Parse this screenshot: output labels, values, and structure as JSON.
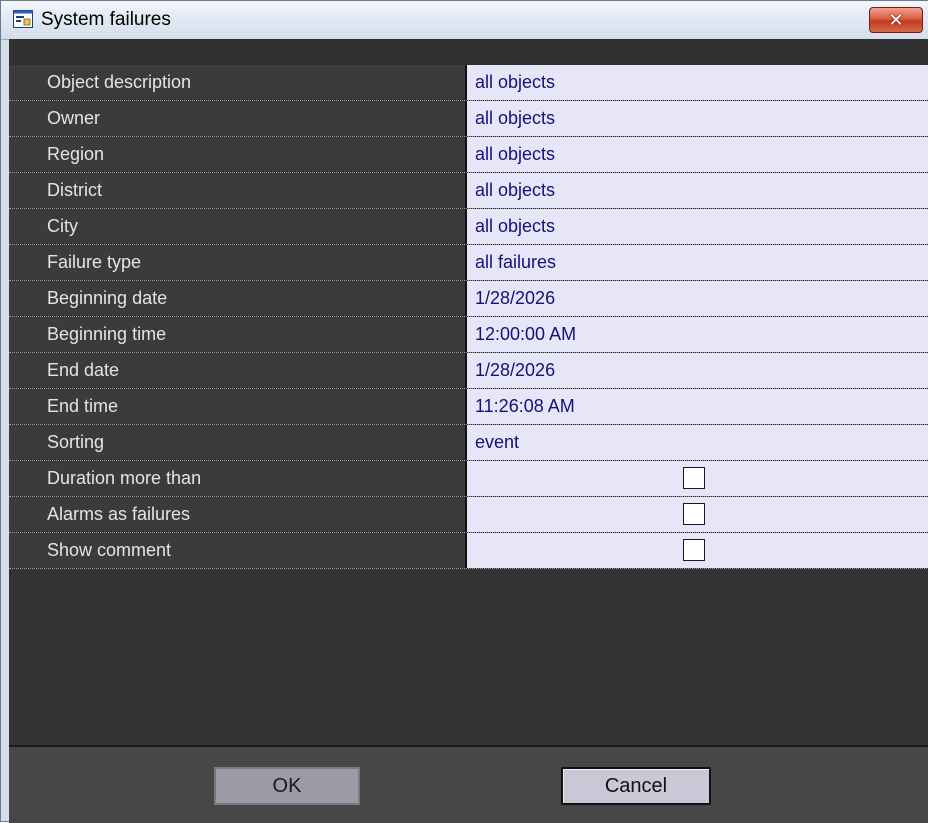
{
  "window": {
    "title": "System failures",
    "icon": "report-window-icon",
    "close_label": "✕"
  },
  "fields": [
    {
      "label": "Object description",
      "value": "all objects"
    },
    {
      "label": "Owner",
      "value": "all objects"
    },
    {
      "label": "Region",
      "value": "all objects"
    },
    {
      "label": "District",
      "value": "all objects"
    },
    {
      "label": "City",
      "value": "all objects"
    },
    {
      "label": "Failure type",
      "value": "all failures"
    },
    {
      "label": "Beginning date",
      "value": "1/28/2026"
    },
    {
      "label": "Beginning time",
      "value": "12:00:00 AM"
    },
    {
      "label": "End date",
      "value": "1/28/2026"
    },
    {
      "label": "End time",
      "value": "11:26:08 AM"
    },
    {
      "label": "Sorting",
      "value": "event"
    }
  ],
  "options": [
    {
      "label": "Duration more than",
      "checked": false
    },
    {
      "label": "Alarms as failures",
      "checked": false
    },
    {
      "label": "Show comment",
      "checked": false
    }
  ],
  "buttons": {
    "ok_label": "OK",
    "cancel_label": "Cancel"
  },
  "colors": {
    "label_bg": "#3b3b3b",
    "value_bg": "#e7e5f8",
    "value_text": "#12127a",
    "close_red": "#c23a1f"
  }
}
